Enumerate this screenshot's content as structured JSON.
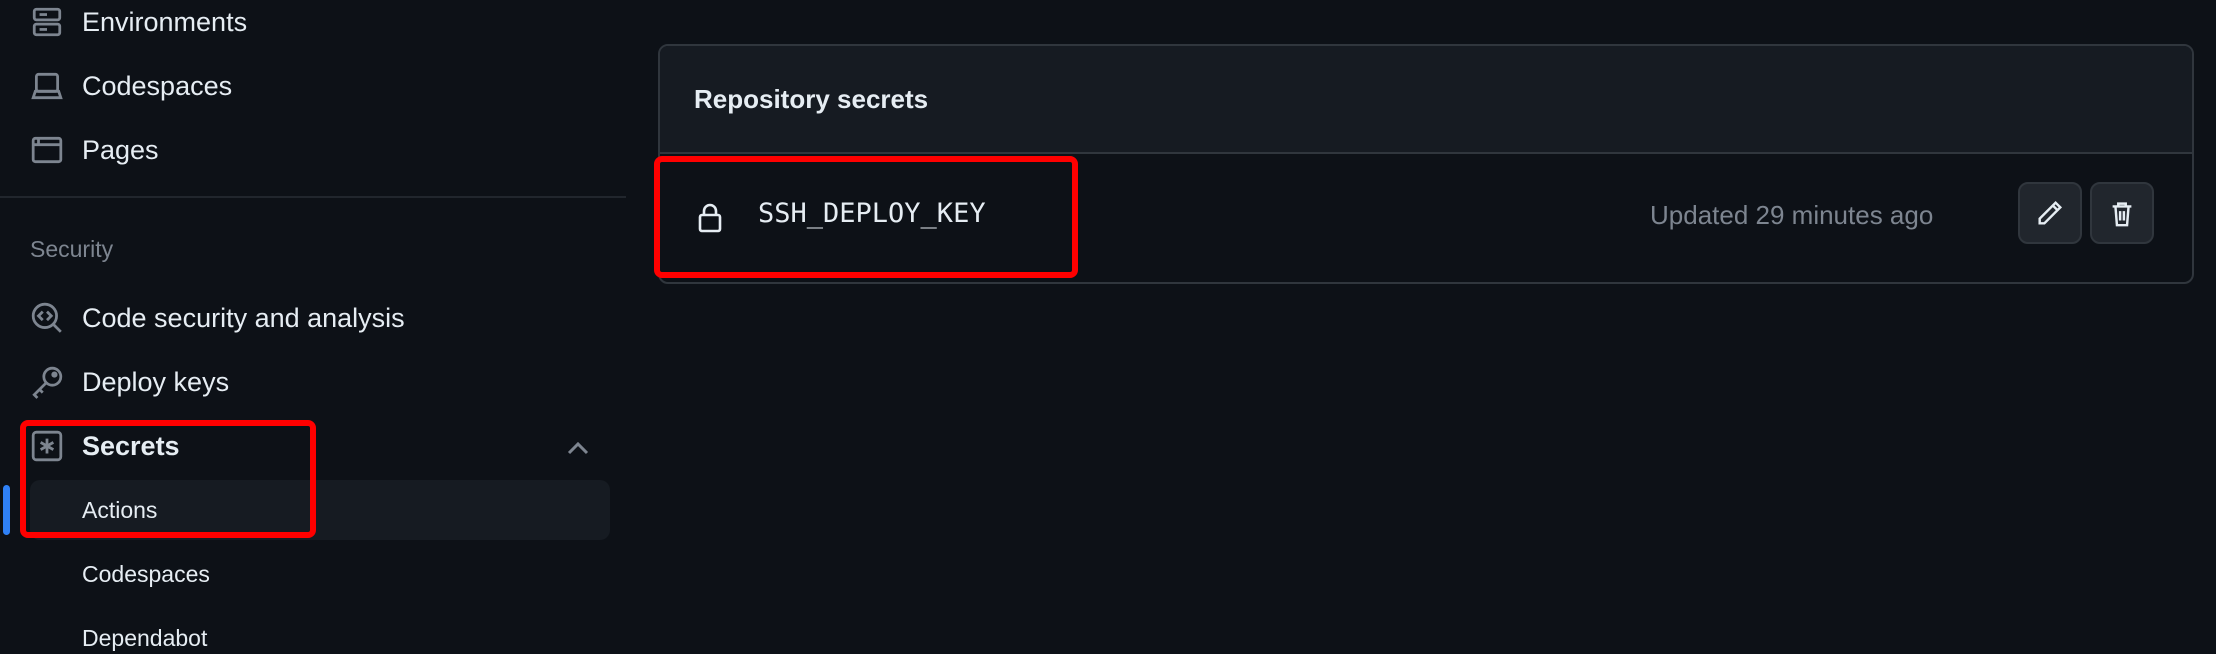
{
  "sidebar": {
    "items_top": [
      {
        "label": "Environments",
        "icon": "server-icon"
      },
      {
        "label": "Codespaces",
        "icon": "laptop-icon"
      },
      {
        "label": "Pages",
        "icon": "browser-icon"
      }
    ],
    "security_section": "Security",
    "items_security": [
      {
        "label": "Code security and analysis",
        "icon": "codescan-icon"
      },
      {
        "label": "Deploy keys",
        "icon": "key-icon"
      },
      {
        "label": "Secrets",
        "icon": "asterisk-icon"
      }
    ],
    "secrets_subitems": [
      {
        "label": "Actions"
      },
      {
        "label": "Codespaces"
      },
      {
        "label": "Dependabot"
      }
    ]
  },
  "main": {
    "box_title": "Repository secrets",
    "secrets": [
      {
        "name": "SSH_DEPLOY_KEY",
        "updated": "Updated 29 minutes ago"
      }
    ]
  },
  "colors": {
    "background": "#0d1117",
    "accent": "#2f81f7",
    "highlight": "#ff0000"
  }
}
